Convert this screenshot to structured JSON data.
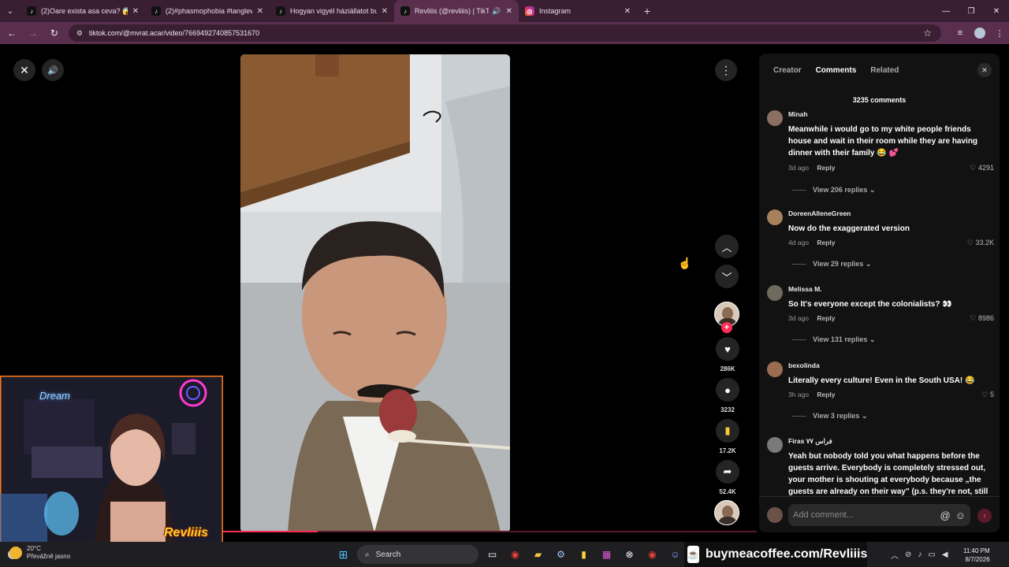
{
  "browser": {
    "tabs": [
      {
        "title": "(2)Oare exista asa ceva? 😱😱😱",
        "icon": "tiktok-icon",
        "active": false
      },
      {
        "title": "(2)#phasmophobia #tanglewood",
        "icon": "tiktok-icon",
        "active": false
      },
      {
        "title": "Hogyan vigyél háziállatot buli",
        "icon": "tiktok-icon",
        "active": false
      },
      {
        "title": "Revliiis (@revliiis) | TikTok",
        "icon": "tiktok-icon",
        "active": true
      },
      {
        "title": "Instagram",
        "icon": "instagram-icon",
        "active": false
      }
    ],
    "new_tab": "+",
    "url": "tiktok.com/@mvrat.acar/video/7669492740857531670"
  },
  "video": {
    "progress": 0.42,
    "close_icon": "✕",
    "volume_icon": "🔊",
    "more_icon": "⋮",
    "prev_icon": "︿",
    "next_icon": "﹀"
  },
  "actions": {
    "likes": "286K",
    "comments": "3232",
    "saves": "17.2K",
    "shares": "52.4K"
  },
  "panel": {
    "tabs": [
      "Creator",
      "Comments",
      "Related"
    ],
    "active_tab": "Comments",
    "comments_count": "3235 comments",
    "comments": [
      {
        "name": "Minah",
        "text": "Meanwhile i would go to my white people friends house and wait in their room while they are having dinner with their family 😂 💕",
        "time": "3d ago",
        "reply": "Reply",
        "likes": "4291",
        "replies": "View 206 replies ⌄",
        "avatar_color": "#8c6f62"
      },
      {
        "name": "DoreenAlleneGreen",
        "text": "Now do the exaggerated version",
        "time": "4d ago",
        "reply": "Reply",
        "likes": "33.2K",
        "replies": "View 29 replies ⌄",
        "avatar_color": "#a7805c"
      },
      {
        "name": "Melissa M.",
        "text": "So It's everyone except the colonialists? 👀",
        "time": "3d ago",
        "reply": "Reply",
        "likes": "8986",
        "replies": "View 131 replies ⌄",
        "avatar_color": "#6e6a5e"
      },
      {
        "name": "bexolinda",
        "text": "Literally every culture! Even in the South USA! 😂",
        "time": "3h ago",
        "reply": "Reply",
        "likes": "5",
        "replies": "View 3 replies ⌄",
        "avatar_color": "#9b6b52"
      },
      {
        "name": "Firas ﻓﺮاس ٧٧",
        "text": "Yeah but nobody told you what happens before the guests arrive. Everybody is completely stressed out, your mother is shouting at everybody because „the guests are already on their way\" (p.s. they're not, still",
        "time": "",
        "reply": "",
        "likes": "",
        "replies": "",
        "avatar_color": "#7a7a7a"
      }
    ],
    "add_comment_placeholder": "Add comment...",
    "mention_icon": "@",
    "emoji_icon": "☺",
    "send_icon": "↑"
  },
  "webcam": {
    "logo": "Revliiis",
    "neon_sign": "Dream"
  },
  "taskbar": {
    "weather_temp": "20°C",
    "weather_desc": "Převážně jasno",
    "search": "Search",
    "promo": "buymeacoffee.com/Revliiis",
    "time": "11:40 PM",
    "date": "8/7/2026"
  }
}
